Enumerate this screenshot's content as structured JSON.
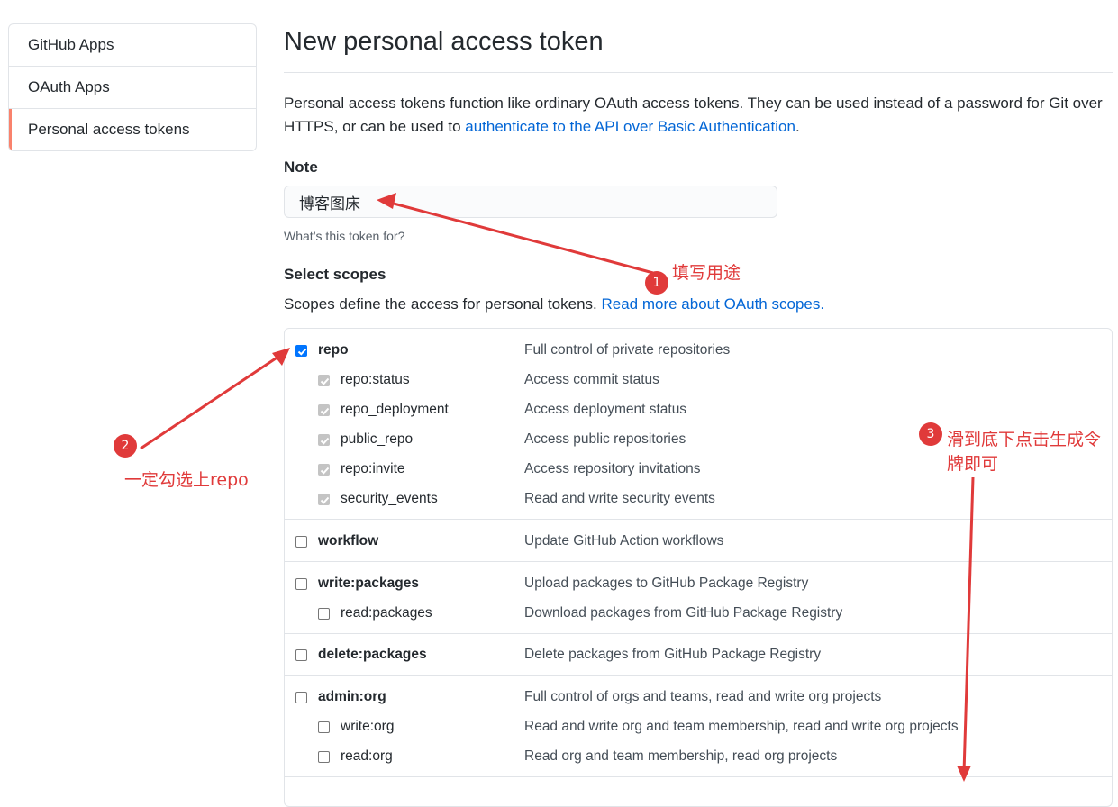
{
  "sidebar": {
    "items": [
      {
        "label": "GitHub Apps"
      },
      {
        "label": "OAuth Apps"
      },
      {
        "label": "Personal access tokens",
        "active": true
      }
    ]
  },
  "page": {
    "title": "New personal access token",
    "intro_text": "Personal access tokens function like ordinary OAuth access tokens. They can be used instead of a password for Git over HTTPS, or can be used to ",
    "intro_link": "authenticate to the API over Basic Authentication",
    "intro_end": "."
  },
  "note": {
    "label": "Note",
    "value": "博客图床",
    "hint": "What’s this token for?"
  },
  "scopes": {
    "label": "Select scopes",
    "desc": "Scopes define the access for personal tokens. ",
    "link": "Read more about OAuth scopes.",
    "rows": [
      {
        "name": "repo",
        "desc": "Full control of private repositories",
        "checked": true
      },
      {
        "name": "repo:status",
        "desc": "Access commit status",
        "checked": true
      },
      {
        "name": "repo_deployment",
        "desc": "Access deployment status",
        "checked": true
      },
      {
        "name": "public_repo",
        "desc": "Access public repositories",
        "checked": true
      },
      {
        "name": "repo:invite",
        "desc": "Access repository invitations",
        "checked": true
      },
      {
        "name": "security_events",
        "desc": "Read and write security events",
        "checked": true
      },
      {
        "name": "workflow",
        "desc": "Update GitHub Action workflows",
        "checked": false
      },
      {
        "name": "write:packages",
        "desc": "Upload packages to GitHub Package Registry",
        "checked": false
      },
      {
        "name": "read:packages",
        "desc": "Download packages from GitHub Package Registry",
        "checked": false
      },
      {
        "name": "delete:packages",
        "desc": "Delete packages from GitHub Package Registry",
        "checked": false
      },
      {
        "name": "admin:org",
        "desc": "Full control of orgs and teams, read and write org projects",
        "checked": false
      },
      {
        "name": "write:org",
        "desc": "Read and write org and team membership, read and write org projects",
        "checked": false
      },
      {
        "name": "read:org",
        "desc": "Read org and team membership, read org projects",
        "checked": false
      }
    ]
  },
  "annotations": {
    "badge1": "1",
    "text1": "填写用途",
    "badge2": "2",
    "text2": "一定勾选上repo",
    "badge3": "3",
    "text3_line1": "滑到底下点击生成令",
    "text3_line2": "牌即可",
    "color": "#e03a3a"
  },
  "colors": {
    "accent": "#0366d6",
    "sidebar_active": "#f9826c",
    "checkbox_checked": "#0075ff"
  }
}
